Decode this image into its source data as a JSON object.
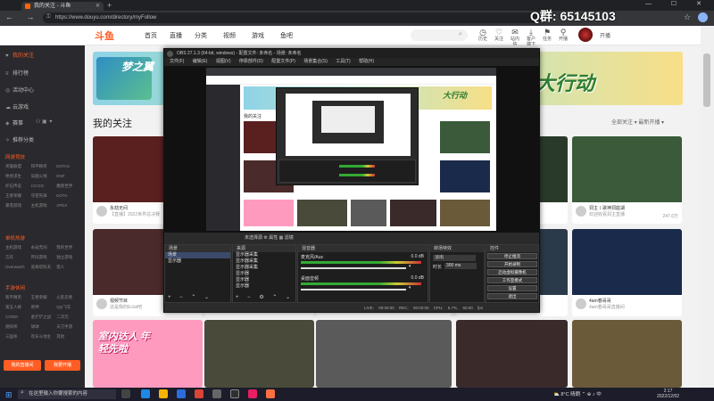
{
  "browser": {
    "tab_title": "我的关注 - 斗鱼",
    "url": "https://www.douyu.com/directory/myFollow",
    "window_controls": "— ☐ ✕",
    "nav_buttons": "← → ↻ ⌂"
  },
  "overlay": {
    "qq_group": "Q群:  65145103"
  },
  "header": {
    "logo": "斗鱼",
    "nav": [
      "首页",
      "直播",
      "分类",
      "视频",
      "游戏",
      "鱼吧"
    ],
    "search_placeholder": "",
    "icons": [
      {
        "icon": "history-icon",
        "glyph": "◷",
        "label": "历史"
      },
      {
        "icon": "follow-icon",
        "glyph": "♡",
        "label": "关注"
      },
      {
        "icon": "fans-icon",
        "glyph": "✉",
        "label": "站内信"
      },
      {
        "icon": "download-icon",
        "glyph": "⤓",
        "label": "客户端下载"
      },
      {
        "icon": "task-icon",
        "glyph": "⚑",
        "label": "任务"
      },
      {
        "icon": "location-icon",
        "glyph": "⚲",
        "label": "开播"
      }
    ],
    "upload_label": "开播"
  },
  "sidebar": {
    "items": [
      {
        "icon": "heart-icon",
        "label": "我的关注",
        "active": true
      },
      {
        "icon": "list-icon",
        "label": "排行榜",
        "active": false
      },
      {
        "icon": "trophy-icon",
        "label": "活动中心",
        "active": false
      },
      {
        "icon": "cloud-icon",
        "label": "云游戏",
        "active": false
      },
      {
        "icon": "match-icon",
        "label": "赛事",
        "active": false
      },
      {
        "icon": "star-icon",
        "label": "推荐分类",
        "active": false
      }
    ],
    "sections": [
      {
        "title": "网游竞技",
        "items": [
          "英雄联盟",
          "和平精英",
          "DOTA2",
          "绝地求生",
          "穿越火线",
          "DNF",
          "炉石传说",
          "CS:GO",
          "魔兽世界",
          "王者荣耀",
          "守望先锋",
          "DOTA",
          "暴雪游戏",
          "主机游戏",
          "APEX"
        ]
      },
      {
        "title": "单机热游",
        "items": [
          "主机游戏",
          "永劫无间",
          "我的世界",
          "方舟",
          "怀旧游戏",
          "独立游戏",
          "Overwatch",
          "逃离塔科夫",
          "猎人"
        ]
      },
      {
        "title": "手游休闲",
        "items": [
          "和平精英",
          "王者荣耀",
          "火影忍者",
          "第五人格",
          "原神",
          "QQ飞车",
          "CODM",
          "金铲铲之战",
          "二次元",
          "阴阳师",
          "球球",
          "天刀手游",
          "三国杀",
          "欢乐斗地主",
          "其他"
        ]
      }
    ],
    "btn_record": "我的直播间",
    "btn_open": "我要开播"
  },
  "main": {
    "banner_text": "大行动",
    "banner_left_text": "梦之翼",
    "title": "我的关注",
    "filters": "全部关注 ▾    最新开播 ▾",
    "cards": [
      {
        "title": "永劫无间",
        "sub": "【直播】2022世界总决赛",
        "count": "",
        "color": "#5a2020"
      },
      {
        "title": "",
        "sub": "",
        "count": "",
        "color": "#3a4a6a"
      },
      {
        "title": "",
        "sub": "",
        "count": "",
        "color": "#2a3a5a"
      },
      {
        "title": "",
        "sub": "",
        "count": "",
        "color": "#2a3a2a"
      },
      {
        "title": "洞主丨歌神洞庭湖",
        "sub": "欢迎收看洞主直播",
        "count": "247.6万",
        "color": "#3a5a3a"
      },
      {
        "title": "视频节目",
        "sub": "这是我的Eclat吧",
        "count": "",
        "color": "#4a2a2a"
      },
      {
        "title": "",
        "sub": "",
        "count": "",
        "color": "#2a2a2a"
      },
      {
        "title": "",
        "sub": "",
        "count": "",
        "color": "#3a3a4a"
      },
      {
        "title": "",
        "sub": "",
        "count": "",
        "color": "#2a3a4a"
      },
      {
        "title": "4am春哥哥",
        "sub": "4am春哥哥直播间",
        "count": "",
        "color": "#1a2a4a"
      },
      {
        "title": "室内达人 年轻先啦",
        "sub": "",
        "count": "",
        "color": "#ff9abf"
      },
      {
        "title": "",
        "sub": "",
        "count": "",
        "color": "#4a4a3a"
      },
      {
        "title": "",
        "sub": "",
        "count": "",
        "color": "#5a5a5a"
      },
      {
        "title": "",
        "sub": "",
        "count": "",
        "color": "#3a2a2a"
      },
      {
        "title": "",
        "sub": "",
        "count": "",
        "color": "#6a5a3a"
      }
    ]
  },
  "obs": {
    "title": "OBS 27.1.3 (64-bit, windows) - 配置文件: 未命名 - 场景: 未命名",
    "menu": "文件(F) 编辑(E) 视图(V) 停靠部件(D) 配置文件(P) 场景集合(S) 工具(T) 帮助(H)",
    "toolbar": "未选择源   ⚙ 属性   ▦ 滤镜",
    "docks": {
      "scenes": {
        "title": "场景",
        "items": [
          "场景",
          "显示器"
        ]
      },
      "sources": {
        "title": "来源",
        "items": [
          "显示器采集",
          "显示器采集",
          "显示器采集",
          "显示器",
          "显示器",
          "显示器"
        ]
      },
      "mixer": {
        "title": "混音器",
        "channels": [
          {
            "name": "麦克风/Aux",
            "db": "0.0 dB"
          },
          {
            "name": "桌面音频",
            "db": "0.0 dB"
          }
        ]
      },
      "transitions": {
        "title": "转场特效",
        "type": "淡出",
        "duration_label": "时长",
        "duration": "300 ms"
      },
      "controls": {
        "title": "控件",
        "buttons": [
          "停止推流",
          "开始录制",
          "启动虚拟摄像机",
          "工作室模式",
          "设置",
          "退出"
        ]
      }
    },
    "status": "LIVE: 00:00:00   REC: 00:00:00   CPU: 5.7%, 60.00 fps"
  },
  "taskbar": {
    "search_placeholder": "在这里输入你要搜索的内容",
    "tray": "⛅ 8°C 晴朗 ⌃ ⊕ ♪ 中",
    "time": "2:17",
    "date": "2022/12/02"
  }
}
